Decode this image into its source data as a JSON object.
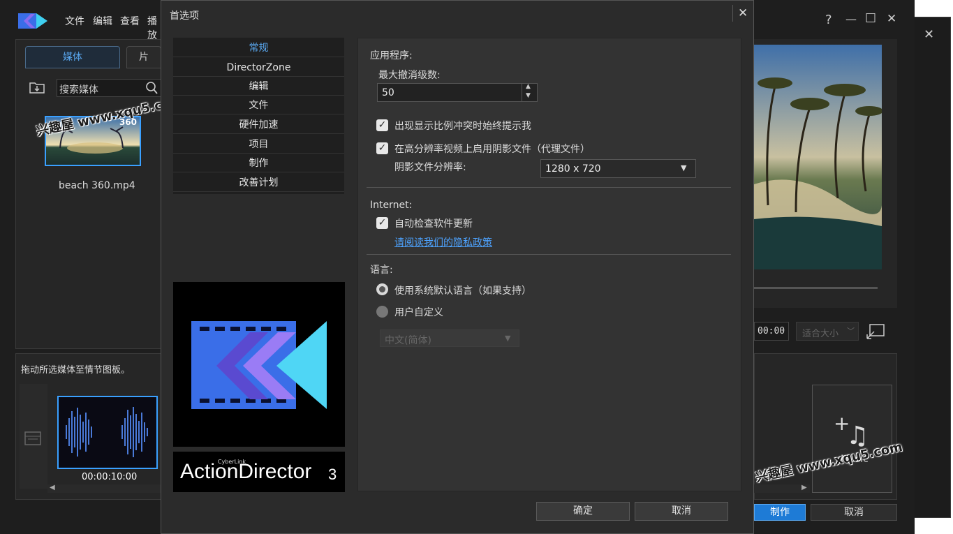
{
  "app": {
    "menu": [
      "文件",
      "编辑",
      "查看",
      "播放"
    ],
    "window_controls": {
      "help": "?",
      "minimize": "—",
      "maximize": "☐",
      "close": "✕"
    },
    "tabs": {
      "media": "媒体",
      "second": "片"
    },
    "search_placeholder": "搜索媒体",
    "media_item": {
      "name": "beach 360.mp4",
      "badge": "360"
    },
    "storyboard_hint": "拖动所选媒体至情节图板。",
    "clip_time": "00:00:10:00",
    "timecode": "00:00",
    "fit_label": "适合大小",
    "music_label": "Music",
    "produce_button": "制作",
    "cancel_button": "取消"
  },
  "dialog": {
    "title": "首选项",
    "nav": [
      "常规",
      "DirectorZone",
      "编辑",
      "文件",
      "硬件加速",
      "项目",
      "制作",
      "改善计划"
    ],
    "nav_selected": 0,
    "product_name": "ActionDirector",
    "product_version": "3",
    "brand": "CyberLink",
    "general": {
      "section_app": "应用程序:",
      "max_undo_label": "最大撤消级数:",
      "max_undo_value": "50",
      "aspect_prompt_label": "出现显示比例冲突时始终提示我",
      "aspect_prompt_checked": true,
      "shadow_file_label": "在高分辨率视频上启用阴影文件（代理文件）",
      "shadow_file_checked": true,
      "shadow_res_label": "阴影文件分辨率:",
      "shadow_res_value": "1280 x 720",
      "section_internet": "Internet:",
      "auto_update_label": "自动检查软件更新",
      "auto_update_checked": true,
      "privacy_link": "请阅读我们的隐私政策",
      "section_language": "语言:",
      "lang_system_label": "使用系统默认语言（如果支持）",
      "lang_custom_label": "用户自定义",
      "lang_selected": "system",
      "lang_dropdown_value": "中文(简体)"
    },
    "ok_button": "确定",
    "cancel_button": "取消"
  },
  "watermark": "兴趣屋 www.xqu5.com",
  "colors": {
    "accent": "#1e7bd6",
    "link": "#4da3ff",
    "logo_blue": "#3a6ee8",
    "logo_purple": "#8a6cf0",
    "logo_cyan": "#3fd0f0"
  }
}
